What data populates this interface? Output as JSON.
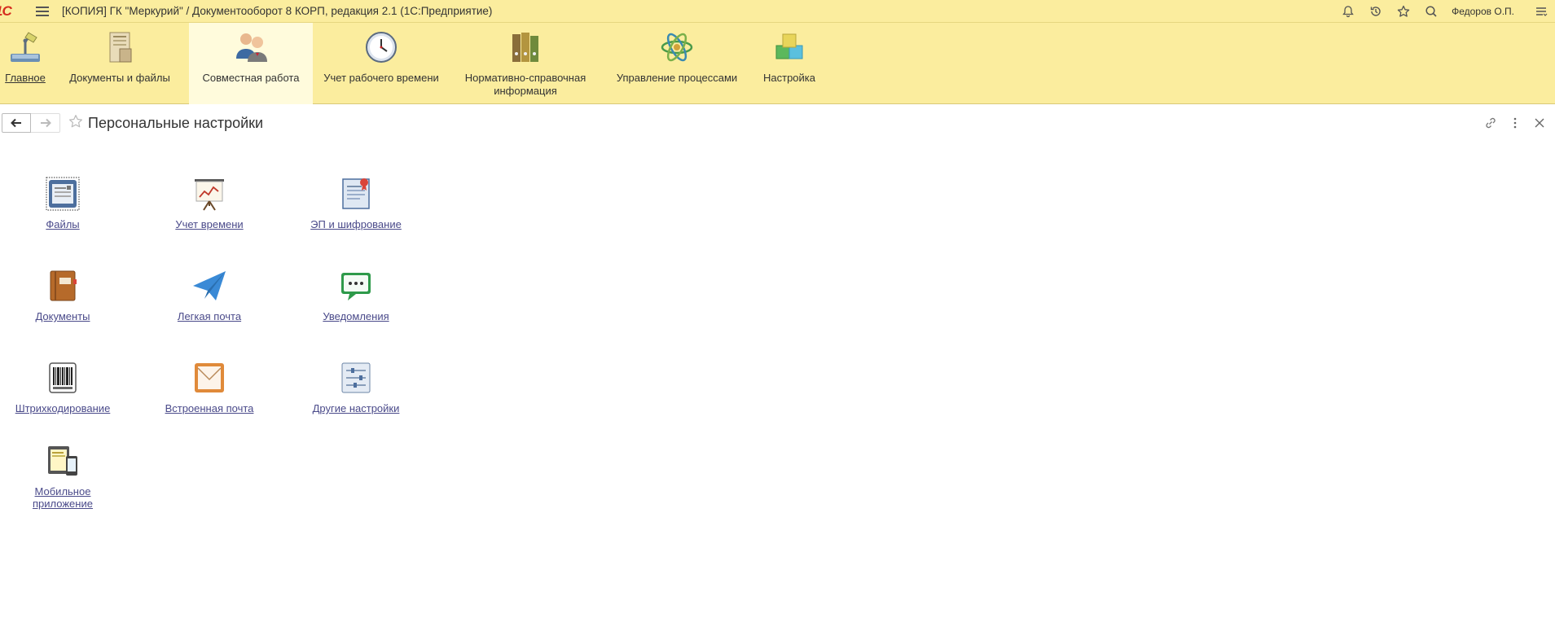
{
  "titlebar": {
    "logo": "1С",
    "title": "[КОПИЯ] ГК \"Меркурий\" / Документооборот 8 КОРП, редакция 2.1  (1С:Предприятие)",
    "user": "Федоров О.П.",
    "icons": [
      "bell-icon",
      "history-icon",
      "star-icon",
      "search-icon",
      "menu-lines-icon"
    ]
  },
  "sections": [
    {
      "label": "Главное",
      "icon": "desk-lamp-icon",
      "active": false
    },
    {
      "label": "Документы и файлы",
      "icon": "documents-box-icon",
      "active": false
    },
    {
      "label": "Совместная работа",
      "icon": "people-icon",
      "active": true
    },
    {
      "label": "Учет рабочего времени",
      "icon": "clock-icon",
      "active": false
    },
    {
      "label": "Нормативно-справочная\nинформация",
      "icon": "binders-icon",
      "active": false
    },
    {
      "label": "Управление процессами",
      "icon": "atom-icon",
      "active": false
    },
    {
      "label": "Настройка",
      "icon": "cubes-icon",
      "active": false
    }
  ],
  "form": {
    "title": "Персональные настройки"
  },
  "items": [
    {
      "label": "Файлы",
      "icon": "file-card-icon"
    },
    {
      "label": "Учет времени",
      "icon": "presentation-chart-icon"
    },
    {
      "label": "ЭП и шифрование",
      "icon": "certificate-icon"
    },
    {
      "label": "Документы",
      "icon": "notebook-icon"
    },
    {
      "label": "Легкая почта",
      "icon": "paper-plane-icon"
    },
    {
      "label": "Уведомления",
      "icon": "chat-bubble-icon"
    },
    {
      "label": "Штрихкодирование",
      "icon": "barcode-icon"
    },
    {
      "label": "Встроенная почта",
      "icon": "envelope-icon"
    },
    {
      "label": "Другие настройки",
      "icon": "sliders-icon"
    },
    {
      "label": "Мобильное\nприложение",
      "icon": "mobile-devices-icon"
    }
  ],
  "colors": {
    "panel": "#fbed9e",
    "active_section": "#fffbdc",
    "link": "#4a4a8a",
    "logo_red": "#d52b1e"
  }
}
